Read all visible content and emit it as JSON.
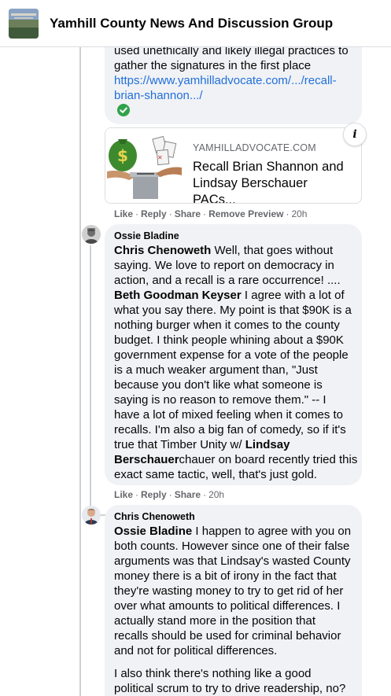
{
  "header": {
    "group_name": "Yamhill County News And Discussion Group"
  },
  "comment_top": {
    "text_line1": "used unethically and likely illegal practices to",
    "text_line2": "gather the signatures in the first place",
    "link_line1": "https://www.yamhilladvocate.com/.../recall-",
    "link_line2": "brian-shannon.../",
    "status_icon": "check-circle-icon"
  },
  "link_preview": {
    "domain": "YAMHILLADVOCATE.COM",
    "title": "Recall Brian Shannon and Lindsay Berschauer PACs...",
    "info_label": "i"
  },
  "actions_1": {
    "like": "Like",
    "reply": "Reply",
    "share": "Share",
    "remove_preview": "Remove Preview",
    "time": "20h"
  },
  "comment_ossie": {
    "author": "Ossie Bladine",
    "mention1": "Chris Chenoweth",
    "l1": " Well, that goes without",
    "l2": "saying. We love to report on democracy in",
    "l3": "action, and a recall is a rare occurrence! ....",
    "mention2": "Beth Goodman Keyser",
    "l4": " I agree with a lot of",
    "l5": "what you say there. My point is that $90K is a",
    "l6": "nothing burger when it comes to the county",
    "l7": "budget. I think people whining about a $90K",
    "l8": "government expense for a vote of the people",
    "l9": "is a much weaker argument than, \"Just",
    "l10": "because you don't like what someone is",
    "l11": "saying is no reason to remove them.\" -- I",
    "l12": "have a lot of mixed feeling when it comes to",
    "l13": "recalls. I'm also a big fan of comedy, so if it's",
    "l14": "true that Timber Unity w/ ",
    "mention3a": "Lindsay",
    "mention3b": "Berschauer",
    "l15": "chauer on board recently tried this",
    "l16": "exact same tactic, well, that's just gold."
  },
  "actions_2": {
    "like": "Like",
    "reply": "Reply",
    "share": "Share",
    "time": "20h"
  },
  "comment_chris": {
    "author": "Chris Chenoweth",
    "mention": "Ossie Bladine",
    "l1": " I happen to agree with you on",
    "l2": "both counts. However since one of their false",
    "l3": "arguments was that Lindsay's wasted County",
    "l4": "money there is a bit of irony in the fact that",
    "l5": "they're wasting money to try to get rid of her",
    "l6": "over what amounts to political differences. I",
    "l7": "actually stand more in the position that",
    "l8": "recalls should be used for criminal behavior",
    "l9": "and not for political differences.",
    "p2l1": "I also think there's nothing like a good",
    "p2l2": "political scrum to try to drive readership, no?"
  },
  "colors": {
    "link": "#216fdb",
    "bubble": "#f0f2f5",
    "meta": "#65676b",
    "check": "#31a24c"
  }
}
